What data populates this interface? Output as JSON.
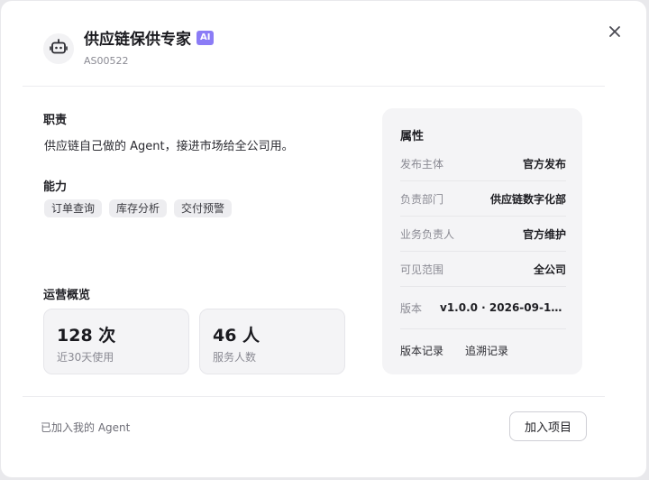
{
  "header": {
    "title": "供应链保供专家",
    "ai_badge": "AI",
    "agent_id": "AS00522",
    "avatar_icon": "robot-icon",
    "close_icon": "close-icon"
  },
  "duties": {
    "heading": "职责",
    "text": "供应链自己做的 Agent，接进市场给全公司用。"
  },
  "capabilities": {
    "heading": "能力",
    "tags": [
      "订单查询",
      "库存分析",
      "交付预警"
    ]
  },
  "overview": {
    "heading": "运营概览",
    "stats": [
      {
        "value": "128 次",
        "label": "近30天使用"
      },
      {
        "value": "46 人",
        "label": "服务人数"
      }
    ]
  },
  "properties": {
    "heading": "属性",
    "rows": [
      {
        "key": "发布主体",
        "value": "官方发布"
      },
      {
        "key": "负责部门",
        "value": "供应链数字化部"
      },
      {
        "key": "业务负责人",
        "value": "官方维护"
      },
      {
        "key": "可见范围",
        "value": "全公司"
      },
      {
        "key": "版本",
        "value": "v1.0.0 · 2026-09-18…"
      }
    ],
    "links": [
      "版本记录",
      "追溯记录"
    ]
  },
  "footer": {
    "status_text": "已加入我的 Agent",
    "join_button": "加入项目"
  },
  "colors": {
    "ai_badge": "#8b7cf6",
    "panel_bg": "#f4f4f6",
    "tag_bg": "#ededf0"
  }
}
